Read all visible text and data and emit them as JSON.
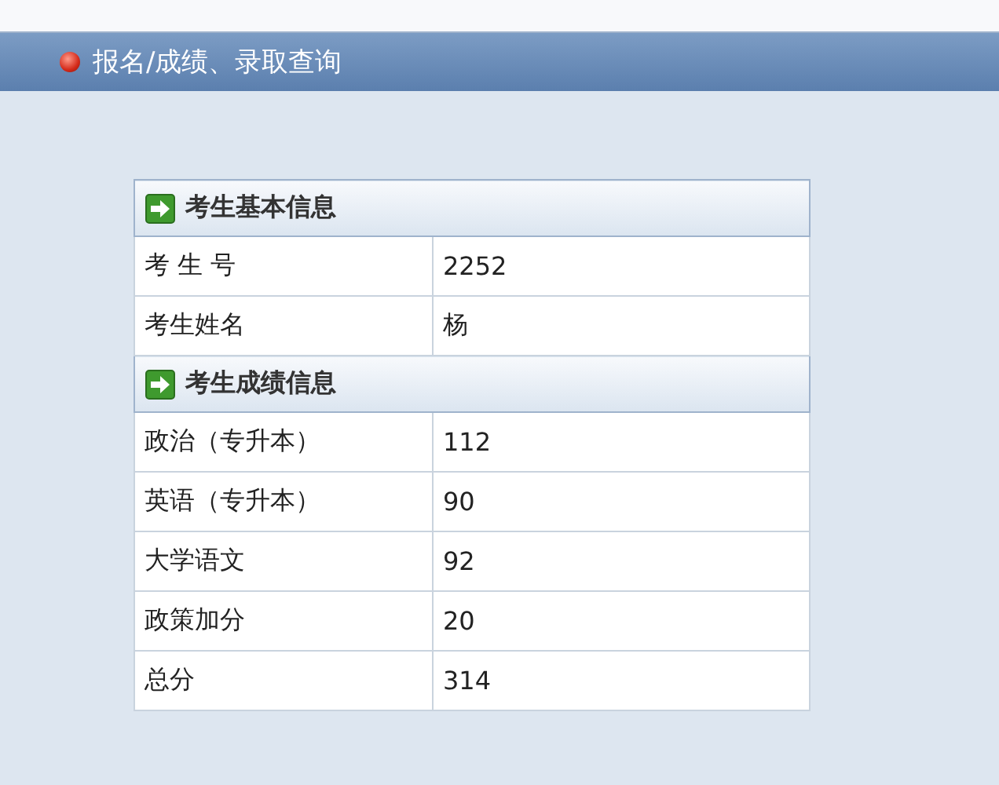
{
  "nav": {
    "items": [
      {
        "label": "报名/成绩、录取查询",
        "kind": "bullet"
      }
    ]
  },
  "sections": [
    {
      "title": "考生基本信息",
      "rows": [
        {
          "label": "考 生 号",
          "value": "2252"
        },
        {
          "label": "考生姓名",
          "value": "杨"
        }
      ]
    },
    {
      "title": "考生成绩信息",
      "rows": [
        {
          "label": "政治（专升本）",
          "value": "112"
        },
        {
          "label": "英语（专升本）",
          "value": "90"
        },
        {
          "label": "大学语文",
          "value": "92"
        },
        {
          "label": "政策加分",
          "value": "20"
        },
        {
          "label": "总分",
          "value": "314"
        }
      ]
    }
  ]
}
